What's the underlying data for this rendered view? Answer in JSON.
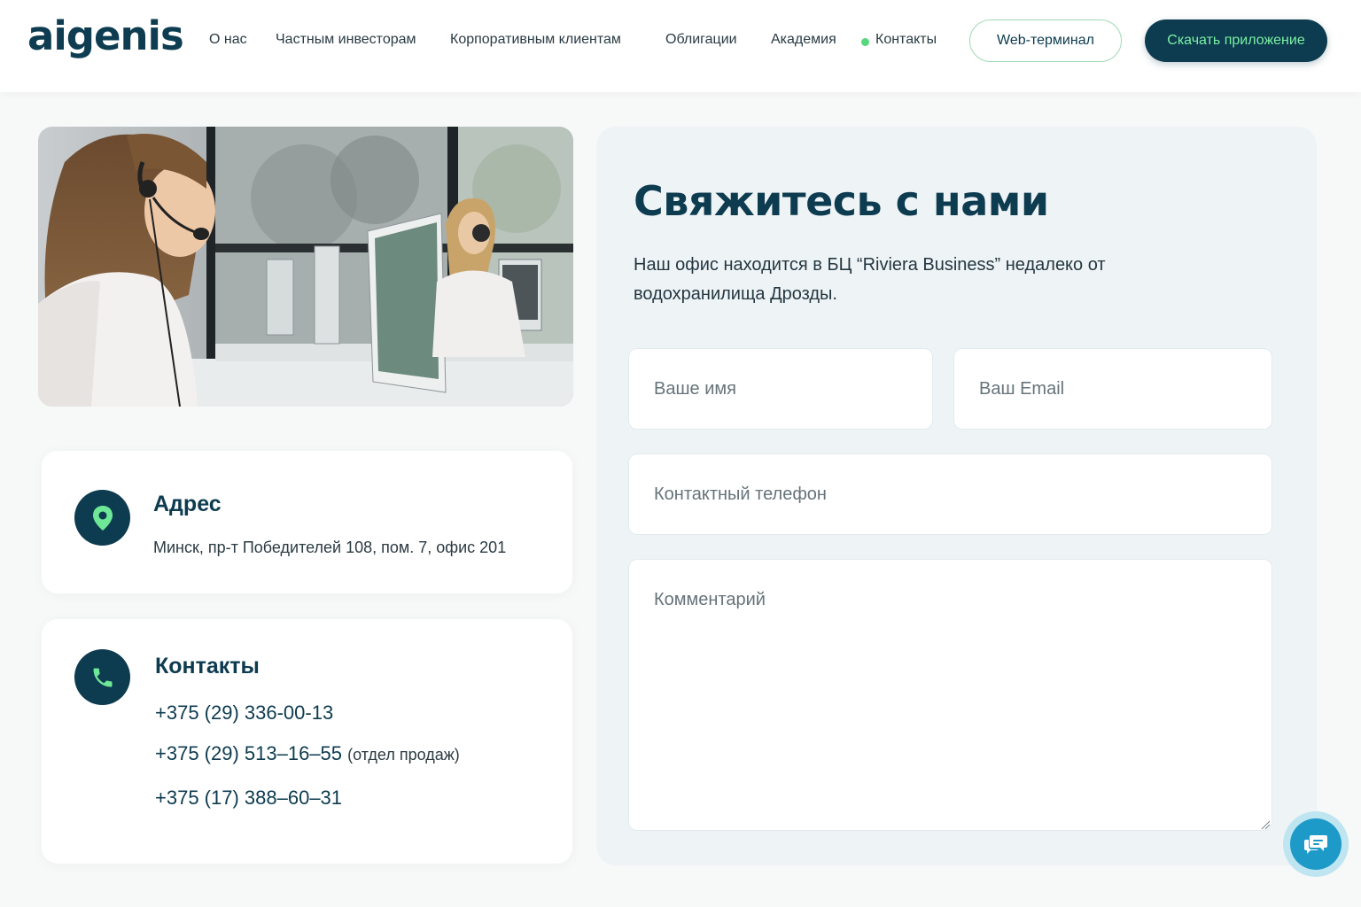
{
  "brand": {
    "logo": "aigenis",
    "primary": "#0d3b4f",
    "accent_green": "#56d87a",
    "chat_blue": "#1e9ac8"
  },
  "nav": {
    "items": [
      {
        "label": "О нас"
      },
      {
        "label": "Частным инвесторам"
      },
      {
        "label": "Корпоративным клиентам"
      },
      {
        "label": "Облигации"
      },
      {
        "label": "Академия"
      },
      {
        "label": "Контакты",
        "active": true
      }
    ],
    "web_terminal": "Web-терминал",
    "download_app": "Скачать приложение"
  },
  "photo": {
    "icon": "call-center-photo"
  },
  "address": {
    "icon": "location-pin-icon",
    "title": "Адрес",
    "text": "Минск, пр-т Победителей 108, пом. 7, офис 201"
  },
  "contacts": {
    "icon": "phone-icon",
    "title": "Контакты",
    "phones": [
      {
        "number": "+375 (29) 336-00-13",
        "note": ""
      },
      {
        "number": "+375 (29) 513–16–55",
        "note": "(отдел продаж)"
      },
      {
        "number": "+375 (17) 388–60–31",
        "note": ""
      }
    ]
  },
  "form": {
    "title": "Свяжитесь с нами",
    "description": "Наш офис находится в БЦ “Riviera Business” недалеко от водохранилища Дрозды.",
    "name_placeholder": "Ваше имя",
    "email_placeholder": "Ваш Email",
    "phone_placeholder": "Контактный телефон",
    "comment_placeholder": "Комментарий"
  },
  "chat": {
    "icon": "chat-bubble-icon"
  }
}
